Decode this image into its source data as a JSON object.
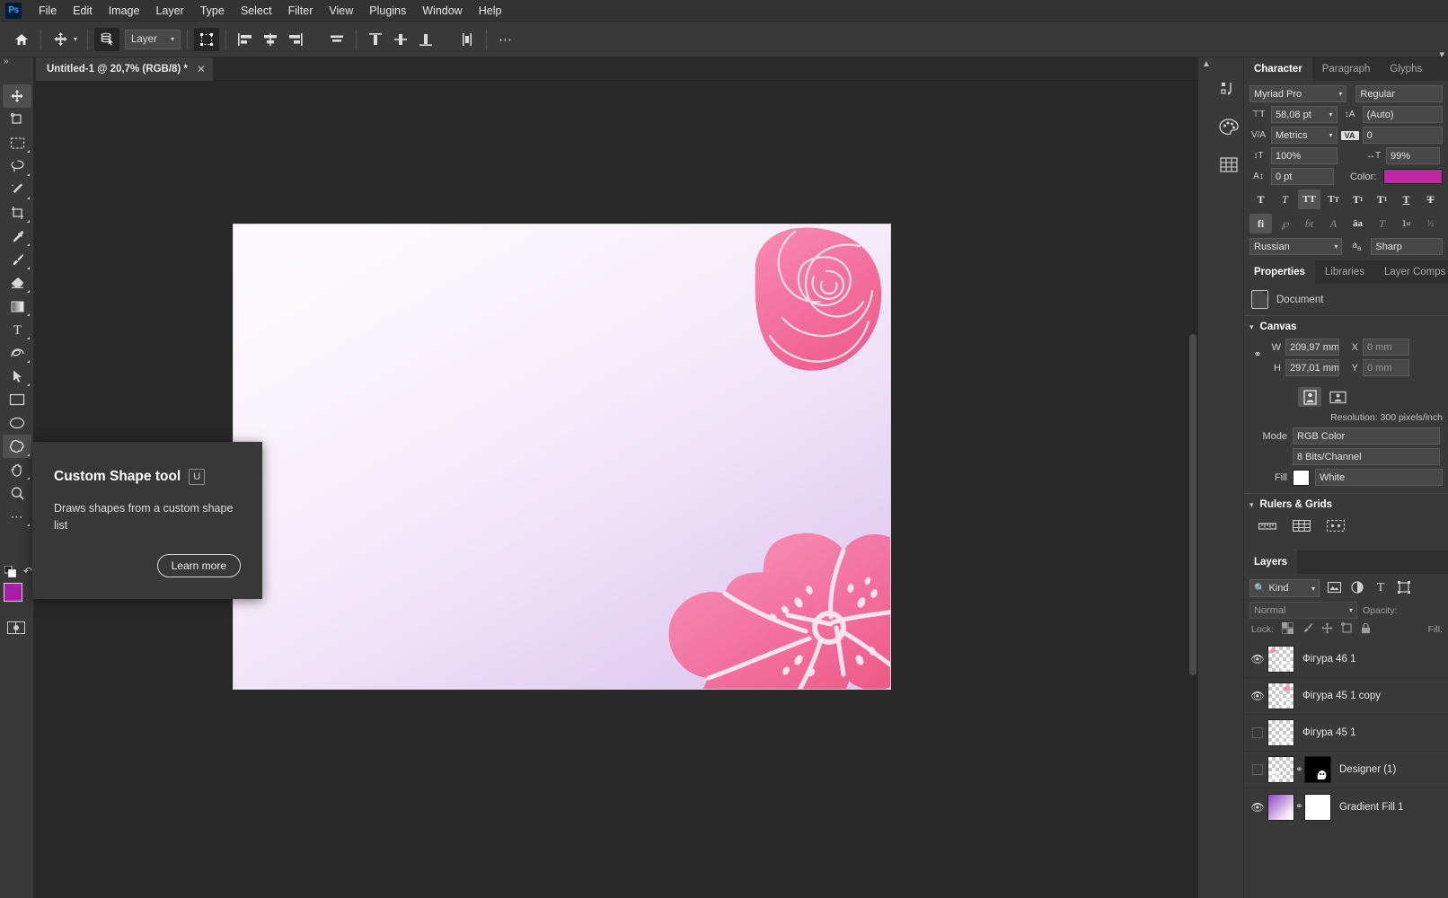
{
  "app": {
    "logo": "Ps"
  },
  "menubar": {
    "items": [
      "File",
      "Edit",
      "Image",
      "Layer",
      "Type",
      "Select",
      "Filter",
      "View",
      "Plugins",
      "Window",
      "Help"
    ]
  },
  "optionsbar": {
    "home_icon": "home-icon",
    "tool_icon": "move-tool-icon",
    "autoselect_icon": "auto-select-icon",
    "layer_select": "Layer",
    "transform_controls_icon": "transform-controls-icon",
    "align": [
      "align-left-edges-icon",
      "align-horizontal-centers-icon",
      "align-right-edges-icon",
      "align-top-edges-icon"
    ],
    "distribute": [
      "distribute-top-icon",
      "distribute-vertical-centers-icon",
      "distribute-bottom-icon",
      "distribute-spacing-icon"
    ],
    "more": "more-options-icon"
  },
  "toolbar": {
    "collapse_icon": "expand-toolbar-icon",
    "tools": [
      {
        "name": "move-tool",
        "icon": "move-icon",
        "active": true,
        "flyout": false
      },
      {
        "name": "artboard-tool",
        "icon": "artboard-icon",
        "active": false,
        "flyout": false
      },
      {
        "name": "rectangular-marquee-tool",
        "icon": "marquee-icon",
        "active": false,
        "flyout": true
      },
      {
        "name": "lasso-tool",
        "icon": "lasso-icon",
        "active": false,
        "flyout": true
      },
      {
        "name": "object-selection-tool",
        "icon": "magic-wand-icon",
        "active": false,
        "flyout": true
      },
      {
        "name": "crop-tool",
        "icon": "crop-icon",
        "active": false,
        "flyout": true
      },
      {
        "name": "eyedropper-tool",
        "icon": "eyedropper-icon",
        "active": false,
        "flyout": true
      },
      {
        "name": "brush-tool",
        "icon": "brush-icon",
        "active": false,
        "flyout": true
      },
      {
        "name": "eraser-tool",
        "icon": "eraser-icon",
        "active": false,
        "flyout": true
      },
      {
        "name": "gradient-tool",
        "icon": "gradient-icon",
        "active": false,
        "flyout": true
      },
      {
        "name": "type-tool",
        "icon": "type-icon",
        "active": false,
        "flyout": true
      },
      {
        "name": "pen-tool",
        "icon": "pen-icon",
        "active": false,
        "flyout": true
      },
      {
        "name": "path-selection-tool",
        "icon": "path-arrow-icon",
        "active": false,
        "flyout": true
      },
      {
        "name": "rectangle-tool",
        "icon": "rectangle-icon",
        "active": false,
        "flyout": false
      },
      {
        "name": "ellipse-tool",
        "icon": "ellipse-icon",
        "active": false,
        "flyout": false
      },
      {
        "name": "custom-shape-tool",
        "icon": "custom-shape-icon",
        "active": true,
        "flyout": true
      },
      {
        "name": "hand-tool",
        "icon": "hand-icon",
        "active": false,
        "flyout": true
      },
      {
        "name": "zoom-tool",
        "icon": "zoom-icon",
        "active": false,
        "flyout": false
      },
      {
        "name": "edit-toolbar",
        "icon": "ellipsis-icon",
        "active": false,
        "flyout": true
      }
    ],
    "foreground_color": "#A71FA7",
    "background_color": "#FFFFFF",
    "swap_icon": "swap-colors-icon",
    "default_colors_icon": "default-colors-icon",
    "quickmask_icon": "quick-mask-icon"
  },
  "document": {
    "tab_title": "Untitled-1 @ 20,7% (RGB/8) *",
    "close_icon": "close-icon"
  },
  "tooltip": {
    "title": "Custom Shape tool",
    "shortcut": "U",
    "body": "Draws shapes from a custom shape list",
    "learn_more": "Learn more"
  },
  "panels": {
    "dock_icons": [
      "history-icon",
      "color-swatches-icon",
      "pattern-grid-icon"
    ],
    "character": {
      "tabs": [
        {
          "label": "Character",
          "active": true
        },
        {
          "label": "Paragraph",
          "active": false
        },
        {
          "label": "Glyphs",
          "active": false
        }
      ],
      "font_family": "Myriad Pro",
      "font_style": "Regular",
      "font_size_icon": "font-size-icon",
      "font_size": "58,08 pt",
      "leading_icon": "leading-icon",
      "leading": "(Auto)",
      "kerning_icon": "kerning-icon",
      "kerning": "Metrics",
      "tracking_icon": "tracking-icon",
      "tracking": "0",
      "vertical_scale_icon": "vertical-scale-icon",
      "vertical_scale": "100%",
      "horizontal_scale_icon": "horizontal-scale-icon",
      "horizontal_scale": "99%",
      "baseline_icon": "baseline-shift-icon",
      "baseline_shift": "0 pt",
      "color_label": "Color:",
      "color_value": "#C026A5",
      "format_buttons": [
        {
          "name": "faux-bold",
          "glyph": "T",
          "on": false,
          "dim": false
        },
        {
          "name": "faux-italic",
          "glyph": "T",
          "on": false,
          "dim": false
        },
        {
          "name": "all-caps",
          "glyph": "TT",
          "on": true,
          "dim": false
        },
        {
          "name": "small-caps",
          "glyph": "Tт",
          "on": false,
          "dim": false
        },
        {
          "name": "superscript",
          "glyph": "T¹",
          "on": false,
          "dim": false
        },
        {
          "name": "subscript",
          "glyph": "T,",
          "on": false,
          "dim": false
        },
        {
          "name": "underline",
          "glyph": "T",
          "on": false,
          "dim": false
        },
        {
          "name": "strikethrough",
          "glyph": "T",
          "on": false,
          "dim": false
        }
      ],
      "opentype_buttons": [
        {
          "name": "standard-ligatures",
          "glyph": "fi",
          "on": true,
          "dim": false
        },
        {
          "name": "contextual-alternates",
          "glyph": "℘",
          "on": false,
          "dim": true
        },
        {
          "name": "discretionary-ligatures",
          "glyph": "ɑ",
          "on": false,
          "dim": true
        },
        {
          "name": "swash",
          "glyph": "𝒜",
          "on": false,
          "dim": true
        },
        {
          "name": "oldstyle",
          "glyph": "aa",
          "on": false,
          "dim": false
        },
        {
          "name": "stylistic-alternates",
          "glyph": "T",
          "on": false,
          "dim": true
        },
        {
          "name": "ordinals",
          "glyph": "1st",
          "on": false,
          "dim": false
        },
        {
          "name": "fractions",
          "glyph": "½",
          "on": false,
          "dim": true
        }
      ],
      "language": "Russian",
      "antialias_icon": "anti-alias-icon",
      "antialias": "Sharp"
    },
    "properties": {
      "tabs": [
        {
          "label": "Properties",
          "active": true
        },
        {
          "label": "Libraries",
          "active": false
        },
        {
          "label": "Layer Comps",
          "active": false
        }
      ],
      "doc_icon": "document-icon",
      "doc_label": "Document",
      "canvas_section": "Canvas",
      "w_label": "W",
      "w_value": "209,97 mm",
      "h_label": "H",
      "h_value": "297,01 mm",
      "x_label": "X",
      "x_value": "0 mm",
      "y_label": "Y",
      "y_value": "0 mm",
      "link_icon": "link-dimensions-icon",
      "orientation_portrait_icon": "orientation-portrait-icon",
      "orientation_landscape_icon": "orientation-landscape-icon",
      "resolution": "Resolution: 300 pixels/inch",
      "mode_label": "Mode",
      "mode_value": "RGB Color",
      "depth_value": "8 Bits/Channel",
      "fill_label": "Fill",
      "fill_color": "#FFFFFF",
      "fill_value": "White",
      "rulers_section": "Rulers & Grids",
      "rulers_icons": [
        "rulers-icon",
        "grid-icon",
        "guides-icon"
      ]
    },
    "layers": {
      "tabs": [
        {
          "label": "Layers",
          "active": true
        }
      ],
      "filter_icon": "search-icon",
      "filter_kind": "Kind",
      "filter_buttons": [
        "pixel-filter-icon",
        "adjustment-filter-icon",
        "type-filter-icon",
        "shape-filter-icon"
      ],
      "blend_mode": "Normal",
      "opacity_label": "Opacity:",
      "lock_label": "Lock:",
      "lock_icons": [
        "lock-transparent-icon",
        "lock-image-icon",
        "lock-position-icon",
        "lock-artboard-icon",
        "lock-all-icon"
      ],
      "fill_label": "Fill:",
      "rows": [
        {
          "name": "Фігура 46 1",
          "visible": true,
          "kind": "shape",
          "has_mask": false
        },
        {
          "name": "Фігура 45 1 copy",
          "visible": true,
          "kind": "shape",
          "has_mask": false
        },
        {
          "name": "Фігура 45 1",
          "visible": false,
          "kind": "shape",
          "has_mask": false
        },
        {
          "name": "Designer (1)",
          "visible": false,
          "kind": "smart",
          "has_mask": true
        },
        {
          "name": "Gradient Fill 1",
          "visible": true,
          "kind": "gradient",
          "has_mask": true
        }
      ]
    }
  }
}
